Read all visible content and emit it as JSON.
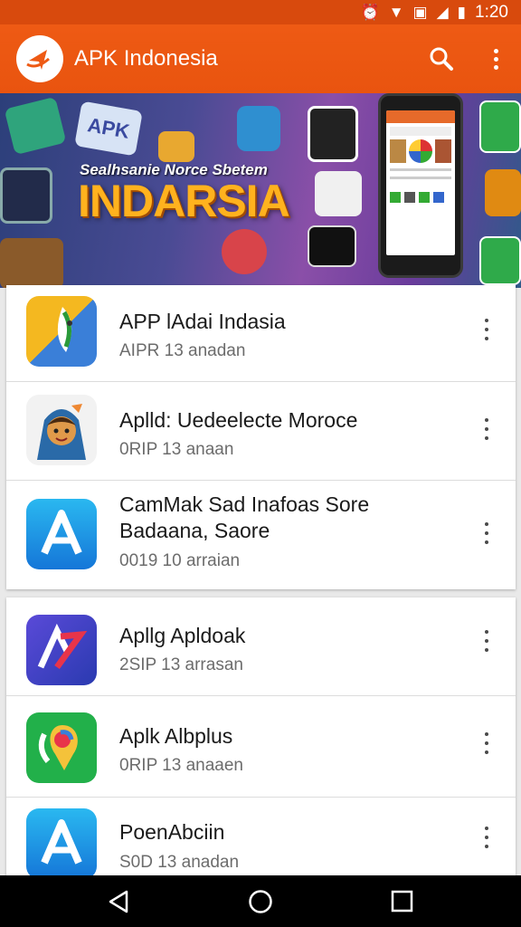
{
  "status_bar": {
    "time": "1:20"
  },
  "header": {
    "title": "APK Indonesia"
  },
  "banner": {
    "subtitle": "Sealhsanie Norce Sbetem",
    "title": "INDARSIA",
    "tile_label": "APK"
  },
  "lists": [
    {
      "items": [
        {
          "title": "APP lAdai Indasia",
          "meta": "AIPR 13 anadan",
          "icon": "green-leaf-app-icon"
        },
        {
          "title": "Aplld: Uedeelecte Moroce",
          "meta": "0RIP 13 anaan",
          "icon": "girl-character-app-icon"
        },
        {
          "title": "CamMak Sad Inafoas Sore\nBadaana, Saore",
          "meta": "0019 10 arraian",
          "icon": "letter-a-app-icon"
        }
      ]
    },
    {
      "items": [
        {
          "title": "Apllg Apldoak",
          "meta": "2SIP 13 arrasan",
          "icon": "purple-a-app-icon"
        },
        {
          "title": "Aplk Albplus",
          "meta": "0RIP 13 anaaen",
          "icon": "green-map-app-icon"
        },
        {
          "title": "PoenAbciin",
          "meta": "S0D 13 anadan",
          "icon": "blue-a-app-icon"
        }
      ]
    }
  ],
  "colors": {
    "primary": "#ee5a14",
    "status": "#d84a0d"
  }
}
